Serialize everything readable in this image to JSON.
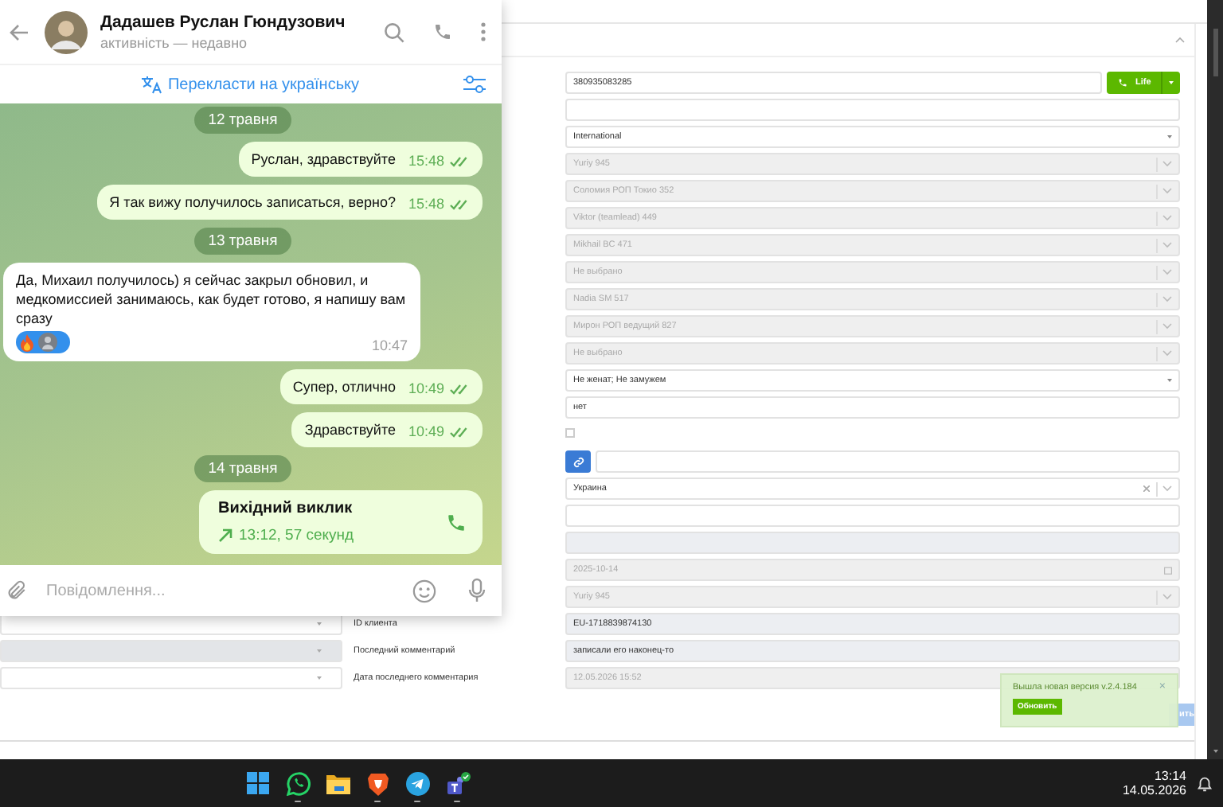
{
  "crm": {
    "phone": "380935083285",
    "call_button": "Life",
    "rows": [
      {
        "kind": "phone"
      },
      {
        "kind": "text"
      },
      {
        "kind": "select",
        "value": "International"
      },
      {
        "kind": "combo",
        "value": "Yuriy 945",
        "disabled": true
      },
      {
        "kind": "combo",
        "value": "Соломия РОП Токио 352",
        "disabled": true
      },
      {
        "kind": "combo",
        "value": "Viktor (teamlead) 449",
        "disabled": true
      },
      {
        "kind": "combo",
        "value": "Mikhail BC 471",
        "disabled": true
      },
      {
        "kind": "combo",
        "value": "Не выбрано",
        "disabled": true
      },
      {
        "kind": "combo",
        "value": "Nadia SM 517",
        "disabled": true
      },
      {
        "kind": "combo",
        "value": "Мирон РОП ведущий 827",
        "disabled": true
      },
      {
        "kind": "combo",
        "value": "Не выбрано",
        "disabled": true
      },
      {
        "kind": "select",
        "value": "Не женат; Не замужем"
      },
      {
        "kind": "text",
        "value": "нет"
      },
      {
        "kind": "checkbox",
        "checked": false
      },
      {
        "kind": "link"
      },
      {
        "kind": "combo",
        "value": "Украина",
        "disabled": false,
        "clearable": true
      },
      {
        "kind": "text"
      },
      {
        "kind": "text",
        "readonly": true
      },
      {
        "kind": "date",
        "value": "2025-10-14"
      },
      {
        "kind": "combo",
        "value": "Yuriy 945",
        "disabled": true
      },
      {
        "kind": "text",
        "readonly": true,
        "value": "EU-1718839874130",
        "label": "ID клиента",
        "side": {
          "disabled": false
        }
      },
      {
        "kind": "text",
        "readonly": true,
        "value": "записали его наконец-то",
        "label": "Последний комментарий",
        "side": {
          "disabled": true
        }
      },
      {
        "kind": "text",
        "disabled": true,
        "value": "12.05.2026 15:52",
        "label": "Дата последнего комментария",
        "side": {
          "disabled": false
        }
      }
    ],
    "save_button": "ить"
  },
  "toast": {
    "message": "Вышла новая версия v.2.4.184",
    "close": "×",
    "button": "Обновить"
  },
  "telegram": {
    "contact_name": "Дадашев Руслан Гюндузович",
    "status": "активність — недавно",
    "translate_label": "Перекласти на українську",
    "input_placeholder": "Повідомлення...",
    "messages": [
      {
        "kind": "date",
        "text": "12 травня"
      },
      {
        "kind": "out",
        "text": "Руслан, здравствуйте",
        "time": "15:48",
        "read": true
      },
      {
        "kind": "out",
        "text": "Я так вижу получилось записаться, верно?",
        "time": "15:48",
        "read": true
      },
      {
        "kind": "date",
        "text": "13 травня"
      },
      {
        "kind": "in",
        "text": "Да, Михаил получилось) я сейчас закрыл обновил, и медкомиссией занимаюсь, как будет готово, я напишу вам сразу",
        "time": "10:47",
        "reacted": true
      },
      {
        "kind": "out",
        "text": "Супер, отлично",
        "time": "10:49",
        "read": true
      },
      {
        "kind": "out",
        "text": "Здравствуйте",
        "time": "10:49",
        "read": true
      },
      {
        "kind": "date",
        "text": "14 травня"
      },
      {
        "kind": "call",
        "title": "Вихідний виклик",
        "detail": "13:12, 57 секунд"
      }
    ]
  },
  "taskbar": {
    "apps": [
      {
        "kind": "start",
        "running": false
      },
      {
        "kind": "whatsapp",
        "running": true
      },
      {
        "kind": "folder",
        "running": false
      },
      {
        "kind": "brave",
        "running": true
      },
      {
        "kind": "telegram",
        "running": true
      },
      {
        "kind": "teams",
        "running": true
      }
    ],
    "time": "13:14",
    "date": "14.05.2026"
  }
}
